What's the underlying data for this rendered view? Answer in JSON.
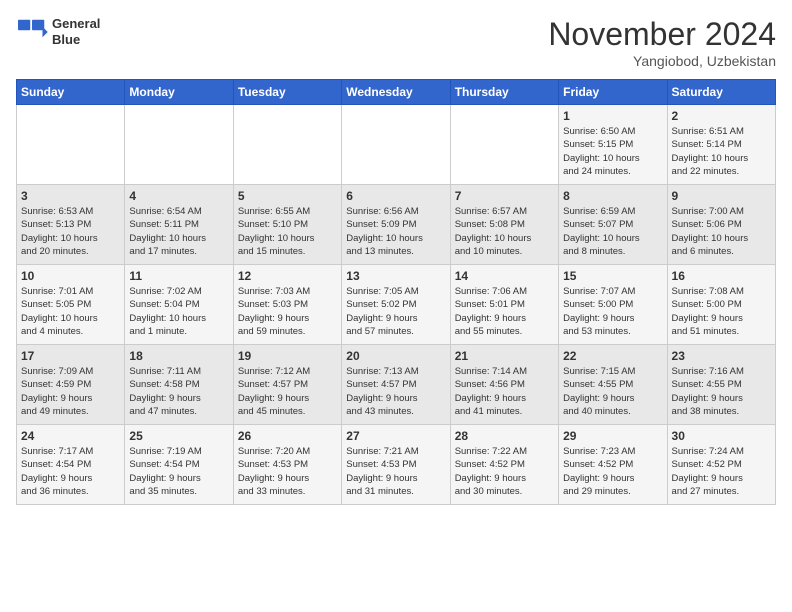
{
  "header": {
    "logo_line1": "General",
    "logo_line2": "Blue",
    "month_title": "November 2024",
    "location": "Yangiobod, Uzbekistan"
  },
  "weekdays": [
    "Sunday",
    "Monday",
    "Tuesday",
    "Wednesday",
    "Thursday",
    "Friday",
    "Saturday"
  ],
  "weeks": [
    [
      {
        "day": "",
        "info": ""
      },
      {
        "day": "",
        "info": ""
      },
      {
        "day": "",
        "info": ""
      },
      {
        "day": "",
        "info": ""
      },
      {
        "day": "",
        "info": ""
      },
      {
        "day": "1",
        "info": "Sunrise: 6:50 AM\nSunset: 5:15 PM\nDaylight: 10 hours\nand 24 minutes."
      },
      {
        "day": "2",
        "info": "Sunrise: 6:51 AM\nSunset: 5:14 PM\nDaylight: 10 hours\nand 22 minutes."
      }
    ],
    [
      {
        "day": "3",
        "info": "Sunrise: 6:53 AM\nSunset: 5:13 PM\nDaylight: 10 hours\nand 20 minutes."
      },
      {
        "day": "4",
        "info": "Sunrise: 6:54 AM\nSunset: 5:11 PM\nDaylight: 10 hours\nand 17 minutes."
      },
      {
        "day": "5",
        "info": "Sunrise: 6:55 AM\nSunset: 5:10 PM\nDaylight: 10 hours\nand 15 minutes."
      },
      {
        "day": "6",
        "info": "Sunrise: 6:56 AM\nSunset: 5:09 PM\nDaylight: 10 hours\nand 13 minutes."
      },
      {
        "day": "7",
        "info": "Sunrise: 6:57 AM\nSunset: 5:08 PM\nDaylight: 10 hours\nand 10 minutes."
      },
      {
        "day": "8",
        "info": "Sunrise: 6:59 AM\nSunset: 5:07 PM\nDaylight: 10 hours\nand 8 minutes."
      },
      {
        "day": "9",
        "info": "Sunrise: 7:00 AM\nSunset: 5:06 PM\nDaylight: 10 hours\nand 6 minutes."
      }
    ],
    [
      {
        "day": "10",
        "info": "Sunrise: 7:01 AM\nSunset: 5:05 PM\nDaylight: 10 hours\nand 4 minutes."
      },
      {
        "day": "11",
        "info": "Sunrise: 7:02 AM\nSunset: 5:04 PM\nDaylight: 10 hours\nand 1 minute."
      },
      {
        "day": "12",
        "info": "Sunrise: 7:03 AM\nSunset: 5:03 PM\nDaylight: 9 hours\nand 59 minutes."
      },
      {
        "day": "13",
        "info": "Sunrise: 7:05 AM\nSunset: 5:02 PM\nDaylight: 9 hours\nand 57 minutes."
      },
      {
        "day": "14",
        "info": "Sunrise: 7:06 AM\nSunset: 5:01 PM\nDaylight: 9 hours\nand 55 minutes."
      },
      {
        "day": "15",
        "info": "Sunrise: 7:07 AM\nSunset: 5:00 PM\nDaylight: 9 hours\nand 53 minutes."
      },
      {
        "day": "16",
        "info": "Sunrise: 7:08 AM\nSunset: 5:00 PM\nDaylight: 9 hours\nand 51 minutes."
      }
    ],
    [
      {
        "day": "17",
        "info": "Sunrise: 7:09 AM\nSunset: 4:59 PM\nDaylight: 9 hours\nand 49 minutes."
      },
      {
        "day": "18",
        "info": "Sunrise: 7:11 AM\nSunset: 4:58 PM\nDaylight: 9 hours\nand 47 minutes."
      },
      {
        "day": "19",
        "info": "Sunrise: 7:12 AM\nSunset: 4:57 PM\nDaylight: 9 hours\nand 45 minutes."
      },
      {
        "day": "20",
        "info": "Sunrise: 7:13 AM\nSunset: 4:57 PM\nDaylight: 9 hours\nand 43 minutes."
      },
      {
        "day": "21",
        "info": "Sunrise: 7:14 AM\nSunset: 4:56 PM\nDaylight: 9 hours\nand 41 minutes."
      },
      {
        "day": "22",
        "info": "Sunrise: 7:15 AM\nSunset: 4:55 PM\nDaylight: 9 hours\nand 40 minutes."
      },
      {
        "day": "23",
        "info": "Sunrise: 7:16 AM\nSunset: 4:55 PM\nDaylight: 9 hours\nand 38 minutes."
      }
    ],
    [
      {
        "day": "24",
        "info": "Sunrise: 7:17 AM\nSunset: 4:54 PM\nDaylight: 9 hours\nand 36 minutes."
      },
      {
        "day": "25",
        "info": "Sunrise: 7:19 AM\nSunset: 4:54 PM\nDaylight: 9 hours\nand 35 minutes."
      },
      {
        "day": "26",
        "info": "Sunrise: 7:20 AM\nSunset: 4:53 PM\nDaylight: 9 hours\nand 33 minutes."
      },
      {
        "day": "27",
        "info": "Sunrise: 7:21 AM\nSunset: 4:53 PM\nDaylight: 9 hours\nand 31 minutes."
      },
      {
        "day": "28",
        "info": "Sunrise: 7:22 AM\nSunset: 4:52 PM\nDaylight: 9 hours\nand 30 minutes."
      },
      {
        "day": "29",
        "info": "Sunrise: 7:23 AM\nSunset: 4:52 PM\nDaylight: 9 hours\nand 29 minutes."
      },
      {
        "day": "30",
        "info": "Sunrise: 7:24 AM\nSunset: 4:52 PM\nDaylight: 9 hours\nand 27 minutes."
      }
    ]
  ]
}
